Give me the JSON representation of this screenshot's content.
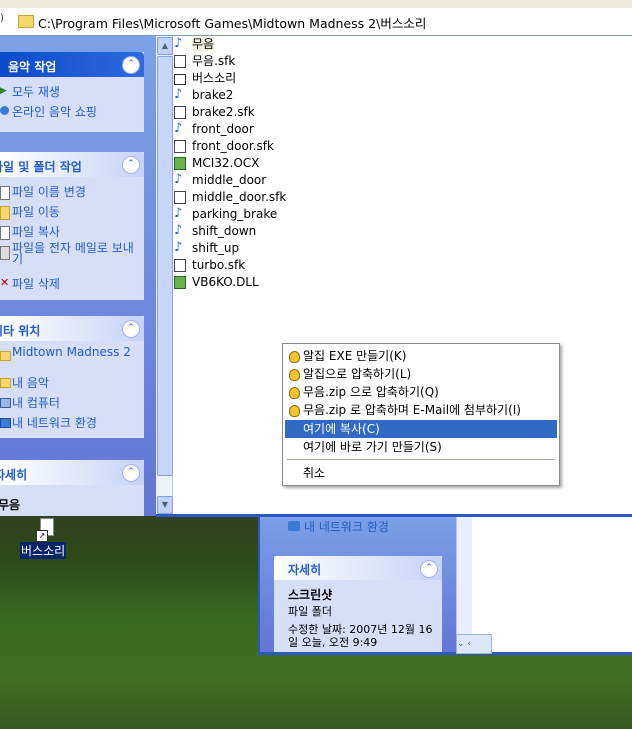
{
  "address": {
    "path": "C:\\Program Files\\Microsoft Games\\Midtown Madness 2\\버스소리"
  },
  "taskpane": {
    "music_tasks": {
      "title": "음악 작업",
      "items": [
        "모두 재생",
        "온라인 음악 쇼핑"
      ]
    },
    "file_tasks": {
      "title": "파일 및 폴더 작업",
      "items": [
        "파일 이름 변경",
        "파일 이동",
        "파일 복사",
        "파일을 전자 메일로 보내기",
        "파일 삭제"
      ]
    },
    "other_places": {
      "title": "기타 위치",
      "items": [
        "Midtown Madness 2",
        "내 음악",
        "내 컴퓨터",
        "내 네트워크 환경"
      ]
    },
    "details": {
      "title": "자세히",
      "value": "무음"
    }
  },
  "files": [
    {
      "name": "무음",
      "type": "audio"
    },
    {
      "name": "무음.sfk",
      "type": "sfk"
    },
    {
      "name": "버스소리",
      "type": "folder"
    },
    {
      "name": "brake2",
      "type": "audio"
    },
    {
      "name": "brake2.sfk",
      "type": "sfk"
    },
    {
      "name": "front_door",
      "type": "audio"
    },
    {
      "name": "front_door.sfk",
      "type": "sfk"
    },
    {
      "name": "MCI32.OCX",
      "type": "ocx"
    },
    {
      "name": "middle_door",
      "type": "audio"
    },
    {
      "name": "middle_door.sfk",
      "type": "sfk"
    },
    {
      "name": "parking_brake",
      "type": "audio"
    },
    {
      "name": "shift_down",
      "type": "audio"
    },
    {
      "name": "shift_up",
      "type": "audio"
    },
    {
      "name": "turbo.sfk",
      "type": "sfk"
    },
    {
      "name": "VB6KO.DLL",
      "type": "ocx"
    }
  ],
  "context_menu": {
    "items": [
      "알집 EXE 만들기(K)",
      "알집으로 압축하기(L)",
      "무음.zip 으로 압축하기(Q)",
      "무음.zip 로 압축하며 E-Mail에 첨부하기(I)",
      "여기에 복사(C)",
      "여기에 바로 가기 만들기(S)",
      "취소"
    ]
  },
  "desktop_icon": {
    "label": "버스소리"
  },
  "back_window": {
    "network_link": "내 네트워크 환경",
    "details_title": "자세히",
    "item_name": "스크린샷",
    "item_type": "파일 폴더",
    "modified": "수정한 날짜: 2007년 12월 16일 오늘, 오전 9:49"
  },
  "colors": {
    "taskpane_gradient_top": "#7ba2e7",
    "menu_highlight": "#316ac5",
    "link_blue": "#215dc6"
  }
}
